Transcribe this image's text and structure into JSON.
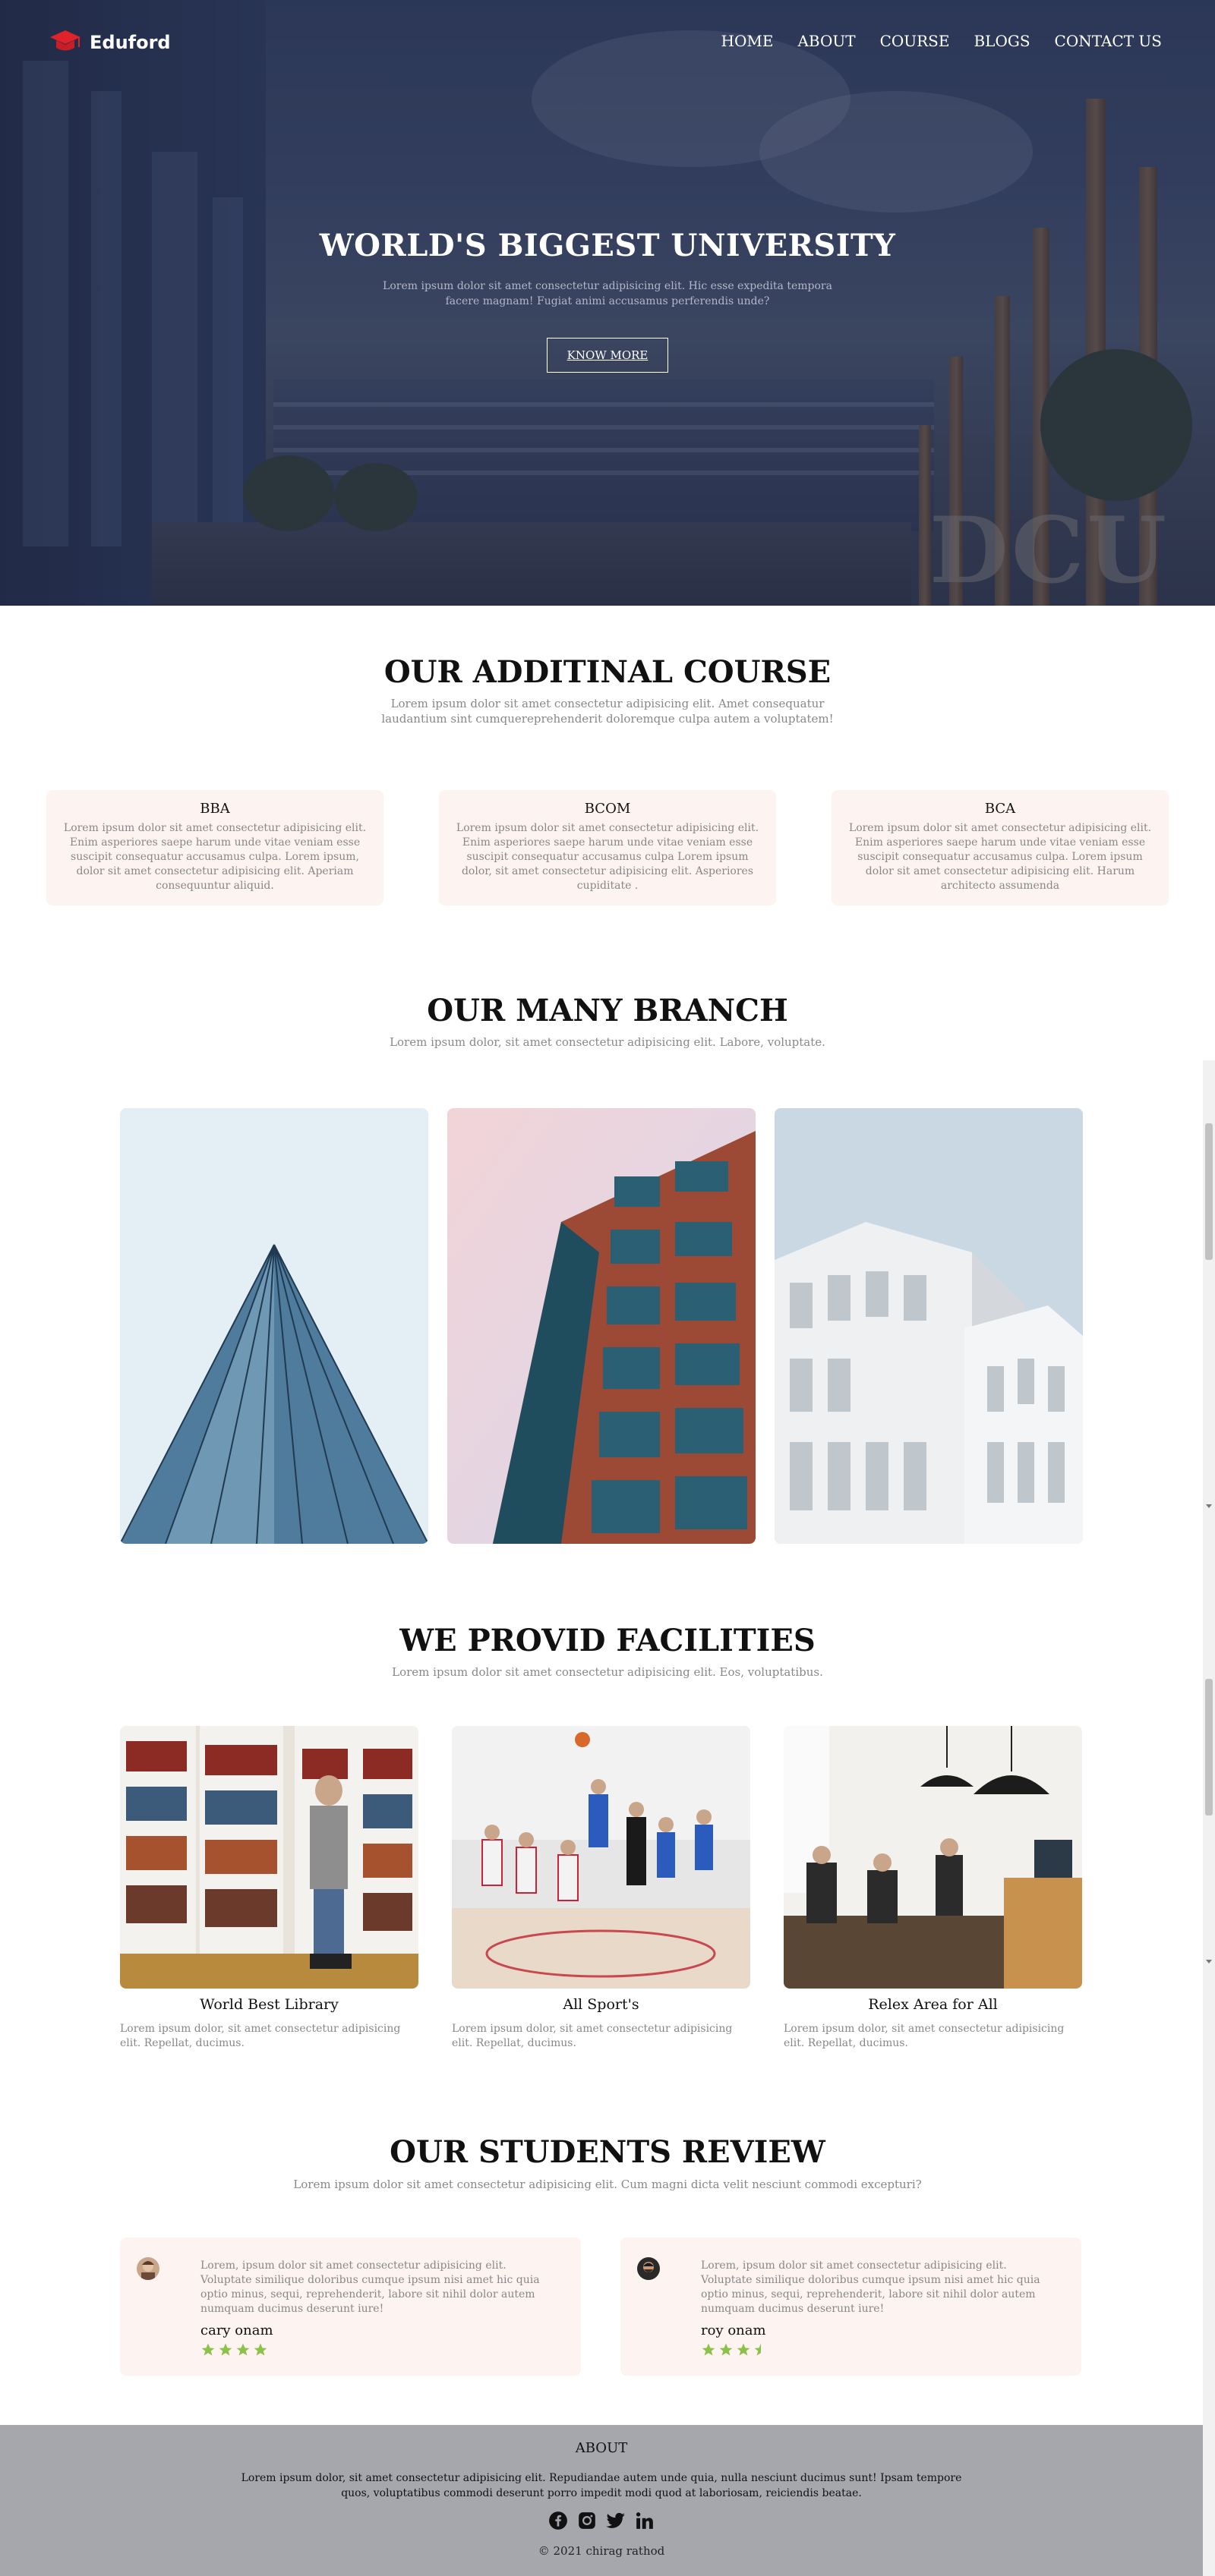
{
  "brand": {
    "name": "Eduford",
    "accent": "#e0232b"
  },
  "nav": {
    "items": [
      "HOME",
      "ABOUT",
      "COURSE",
      "BLOGS",
      "CONTACT US"
    ]
  },
  "hero": {
    "title": "WORLD'S BIGGEST UNIVERSITY",
    "subtitle": "Lorem ipsum dolor sit amet consectetur adipisicing elit. Hic esse expedita tempora facere magnam! Fugiat animi accusamus perferendis unde?",
    "button": "KNOW MORE",
    "sign_text": "DCU"
  },
  "courses": {
    "title": "OUR ADDITINAL COURSE",
    "subtitle": "Lorem ipsum dolor sit amet consectetur adipisicing elit. Amet consequatur laudantium sint cumquereprehenderit doloremque culpa autem a voluptatem!",
    "cards": [
      {
        "name": "BBA",
        "text": "Lorem ipsum dolor sit amet consectetur adipisicing elit. Enim asperiores saepe harum unde vitae veniam esse suscipit consequatur accusamus culpa. Lorem ipsum, dolor sit amet consectetur adipisicing elit. Aperiam consequuntur aliquid."
      },
      {
        "name": "BCOM",
        "text": "Lorem ipsum dolor sit amet consectetur adipisicing elit. Enim asperiores saepe harum unde vitae veniam esse suscipit consequatur accusamus culpa Lorem ipsum dolor, sit amet consectetur adipisicing elit. Asperiores cupiditate ."
      },
      {
        "name": "BCA",
        "text": "Lorem ipsum dolor sit amet consectetur adipisicing elit. Enim asperiores saepe harum unde vitae veniam esse suscipit consequatur accusamus culpa. Lorem ipsum dolor sit amet consectetur adipisicing elit. Harum architecto assumenda"
      }
    ]
  },
  "branches": {
    "title": "OUR MANY BRANCH",
    "subtitle": "Lorem ipsum dolor, sit amet consectetur adipisicing elit. Labore, voluptate."
  },
  "facilities": {
    "title": "WE PROVID FACILITIES",
    "subtitle": "Lorem ipsum dolor sit amet consectetur adipisicing elit. Eos, voluptatibus.",
    "items": [
      {
        "name": "World Best Library",
        "text": "Lorem ipsum dolor, sit amet consectetur adipisicing elit. Repellat, ducimus."
      },
      {
        "name": "All Sport's",
        "text": "Lorem ipsum dolor, sit amet consectetur adipisicing elit. Repellat, ducimus."
      },
      {
        "name": "Relex Area for All",
        "text": "Lorem ipsum dolor, sit amet consectetur adipisicing elit. Repellat, ducimus."
      }
    ]
  },
  "reviews": {
    "title": "OUR STUDENTS REVIEW",
    "subtitle": "Lorem ipsum dolor sit amet consectetur adipisicing elit. Cum magni dicta velit nesciunt commodi excepturi?",
    "items": [
      {
        "text": "Lorem, ipsum dolor sit amet consectetur adipisicing elit. Voluptate similique doloribus cumque ipsum nisi amet hic quia optio minus, sequi, reprehenderit, labore sit nihil dolor autem numquam ducimus deserunt iure!",
        "name": "cary onam",
        "rating": 4
      },
      {
        "text": "Lorem, ipsum dolor sit amet consectetur adipisicing elit. Voluptate similique doloribus cumque ipsum nisi amet hic quia optio minus, sequi, reprehenderit, labore sit nihil dolor autem numquam ducimus deserunt iure!",
        "name": "roy onam",
        "rating": 3.5
      }
    ],
    "star_color": "#8bc34a"
  },
  "footer": {
    "title": "ABOUT",
    "text": "Lorem ipsum dolor, sit amet consectetur adipisicing elit. Repudiandae autem unde quia, nulla nesciunt ducimus sunt! Ipsam tempore quos, voluptatibus commodi deserunt porro impedit modi quod at laboriosam, reiciendis beatae.",
    "socials": [
      "facebook-icon",
      "instagram-icon",
      "twitter-icon",
      "linkedin-icon"
    ],
    "copyright": "© 2021 chirag rathod"
  }
}
